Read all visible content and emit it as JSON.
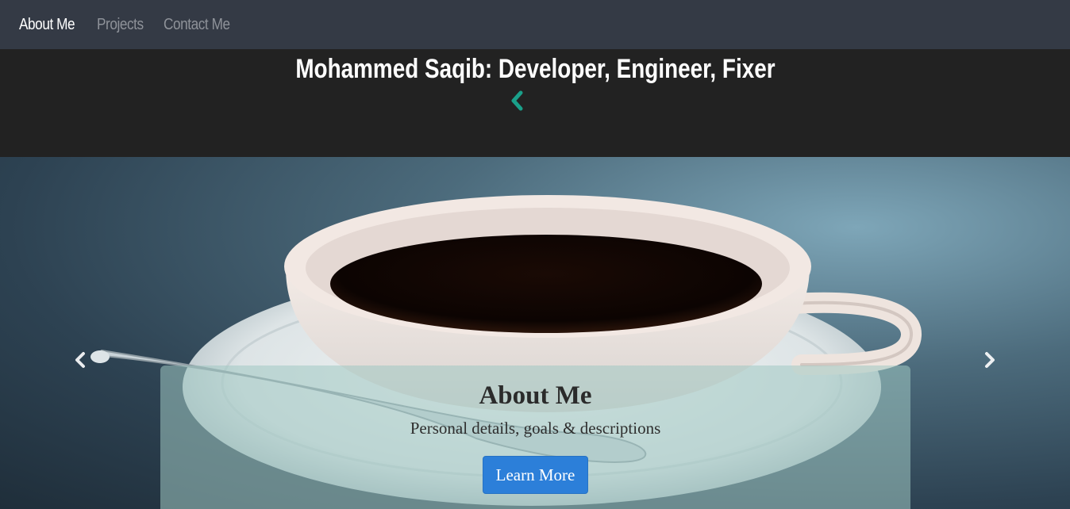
{
  "navbar": {
    "links": [
      {
        "label": "About Me",
        "active": true
      },
      {
        "label": "Projects",
        "active": false
      },
      {
        "label": "Contact Me",
        "active": false
      }
    ]
  },
  "header": {
    "title": "Mohammed Saqib: Developer, Engineer, Fixer",
    "accent_color": "#1aa08a",
    "icon": "chevron-left-icon"
  },
  "carousel": {
    "prev_icon": "chevron-left-icon",
    "next_icon": "chevron-right-icon",
    "slide": {
      "image_subject": "coffee-cup-on-saucer",
      "caption_title": "About Me",
      "caption_subtitle": "Personal details, goals & descriptions",
      "button_label": "Learn More",
      "button_color": "#2c7fd9"
    }
  }
}
